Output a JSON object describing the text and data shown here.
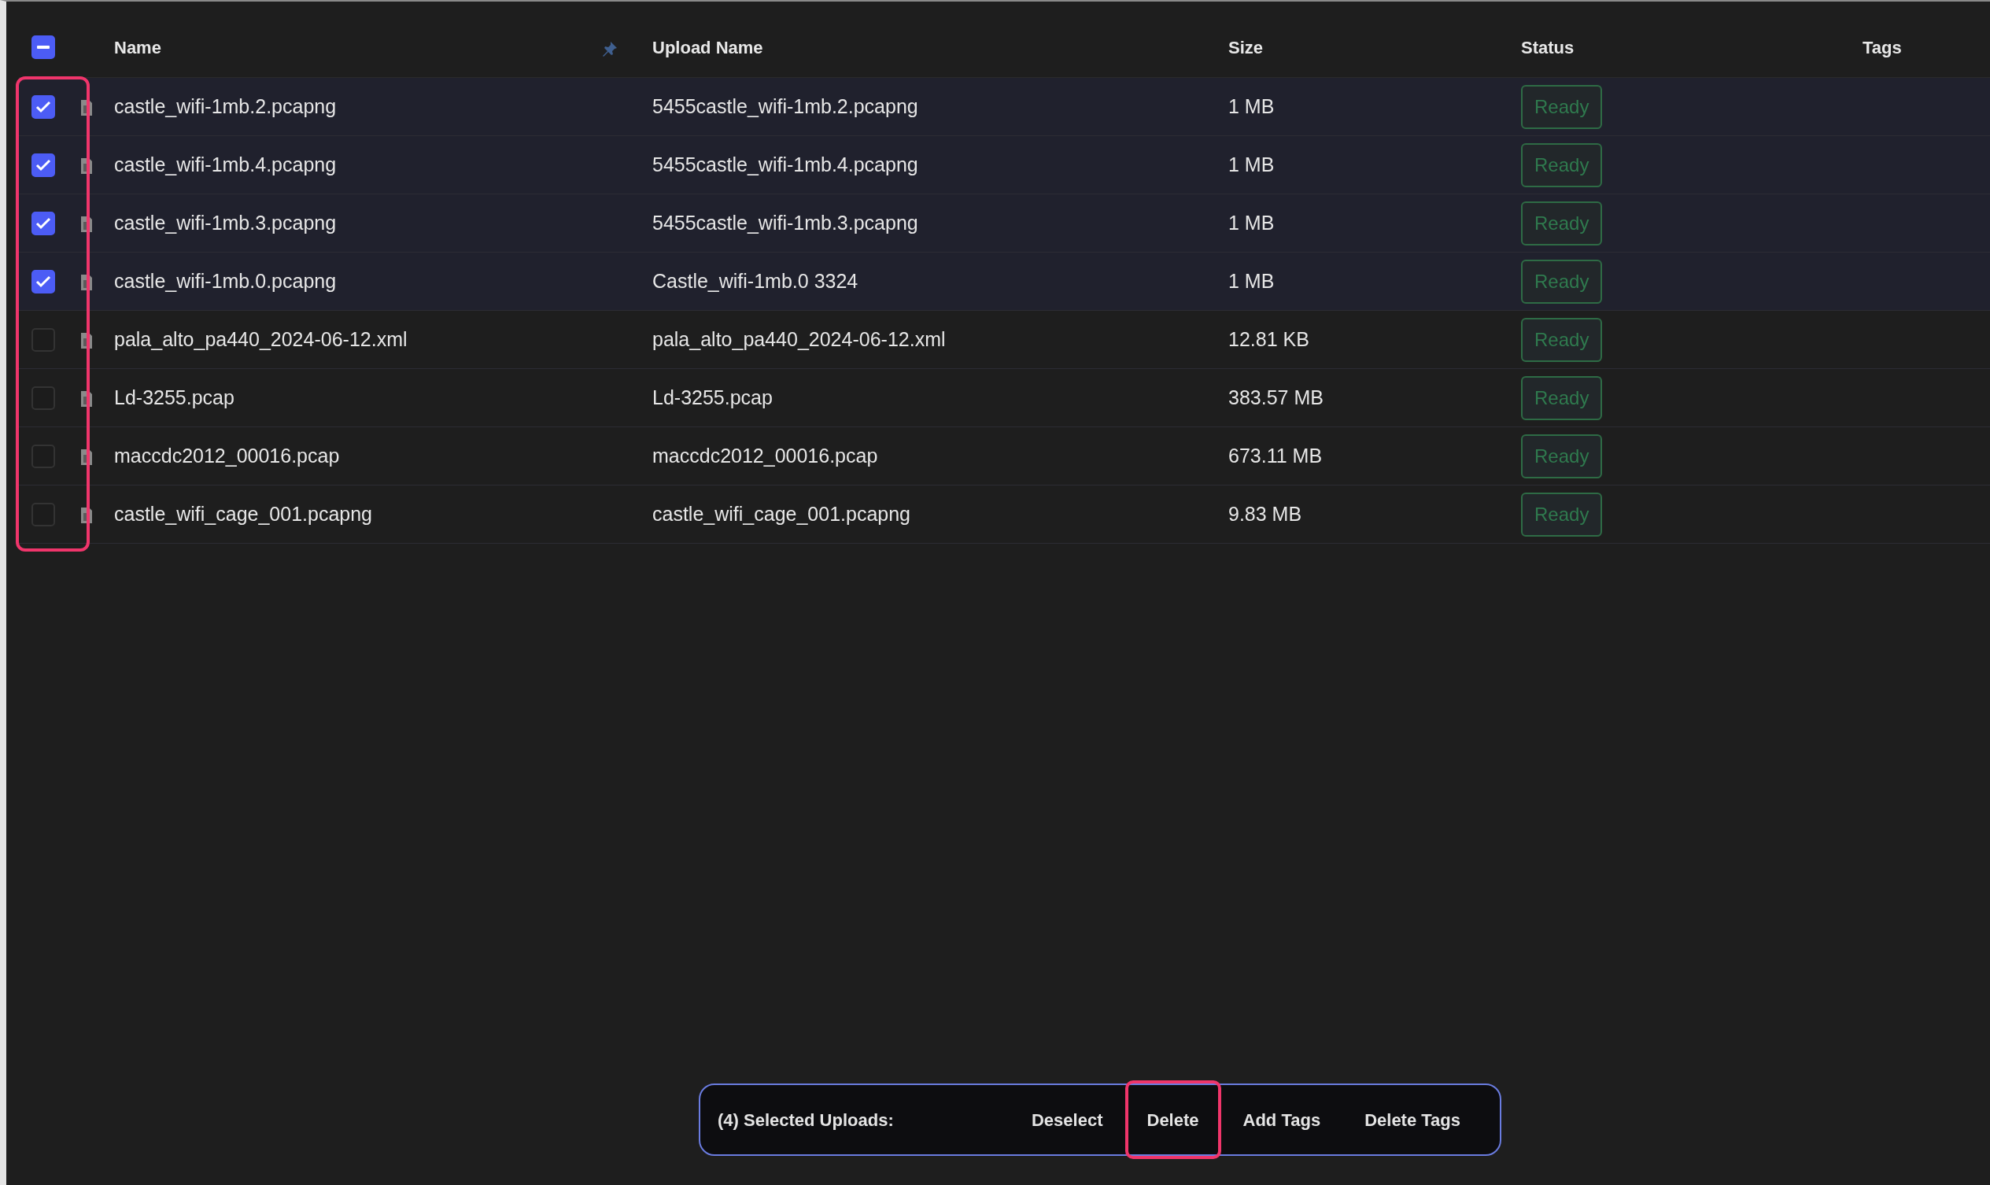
{
  "table": {
    "header_checkbox": {
      "indeterminate": true
    },
    "columns": [
      "Name",
      "Upload Name",
      "Size",
      "Status",
      "Tags"
    ],
    "name_pinned": true,
    "selection_column_highlighted": true,
    "rows": [
      {
        "name": "castle_wifi-1mb.2.pcapng",
        "upload_name": "5455castle_wifi-1mb.2.pcapng",
        "size": "1 MB",
        "status": "Ready",
        "selected": true
      },
      {
        "name": "castle_wifi-1mb.4.pcapng",
        "upload_name": "5455castle_wifi-1mb.4.pcapng",
        "size": "1 MB",
        "status": "Ready",
        "selected": true
      },
      {
        "name": "castle_wifi-1mb.3.pcapng",
        "upload_name": "5455castle_wifi-1mb.3.pcapng",
        "size": "1 MB",
        "status": "Ready",
        "selected": true
      },
      {
        "name": "castle_wifi-1mb.0.pcapng",
        "upload_name": "Castle_wifi-1mb.0 3324",
        "size": "1 MB",
        "status": "Ready",
        "selected": true
      },
      {
        "name": "pala_alto_pa440_2024-06-12.xml",
        "upload_name": "pala_alto_pa440_2024-06-12.xml",
        "size": "12.81 KB",
        "status": "Ready",
        "selected": false
      },
      {
        "name": "Ld-3255.pcap",
        "upload_name": "Ld-3255.pcap",
        "size": "383.57 MB",
        "status": "Ready",
        "selected": false
      },
      {
        "name": "maccdc2012_00016.pcap",
        "upload_name": "maccdc2012_00016.pcap",
        "size": "673.11 MB",
        "status": "Ready",
        "selected": false
      },
      {
        "name": "castle_wifi_cage_001.pcapng",
        "upload_name": "castle_wifi_cage_001.pcapng",
        "size": "9.83 MB",
        "status": "Ready",
        "selected": false
      }
    ]
  },
  "selection_bar": {
    "label": "(4) Selected Uploads:",
    "actions": [
      {
        "label": "Deselect",
        "highlighted": false
      },
      {
        "label": "Delete",
        "highlighted": true
      },
      {
        "label": "Add Tags",
        "highlighted": false
      },
      {
        "label": "Delete Tags",
        "highlighted": false
      }
    ]
  }
}
